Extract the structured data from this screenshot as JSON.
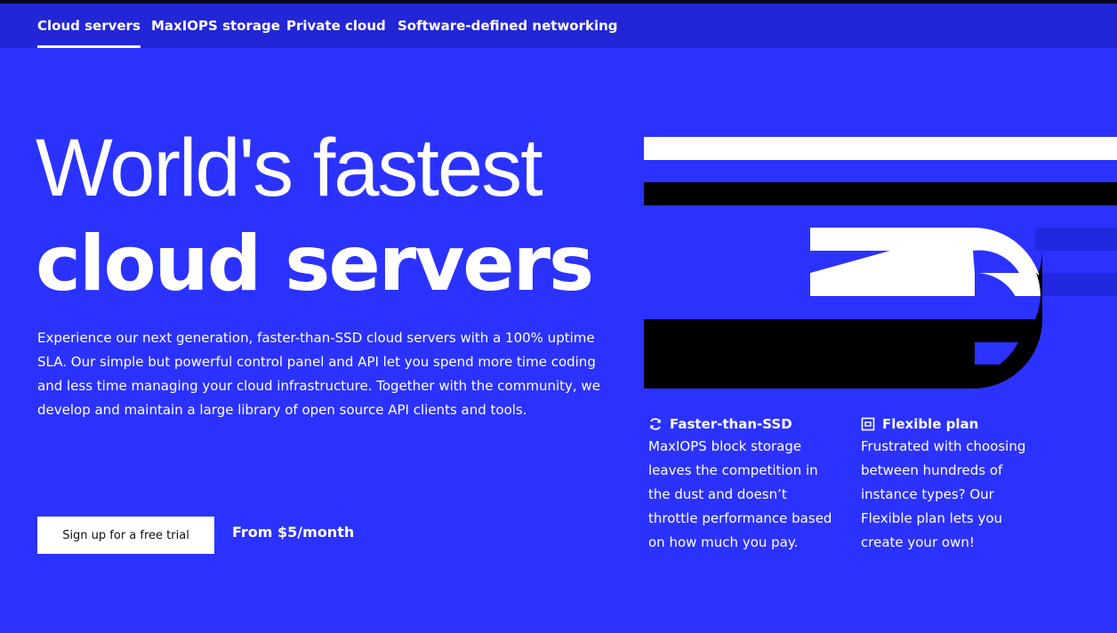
{
  "nav": {
    "items": [
      {
        "label": "Cloud servers",
        "active": true
      },
      {
        "label": "MaxIOPS storage",
        "active": false
      },
      {
        "label": "Private cloud",
        "active": false
      },
      {
        "label": "Software-defined networking",
        "active": false
      }
    ]
  },
  "hero": {
    "headline_line1": "World's fastest",
    "headline_line2": "cloud servers",
    "description": "Experience our next generation, faster-than-SSD cloud servers with a 100% uptime SLA. Our simple but powerful control panel and API let you spend more time coding and less time managing your cloud infrastructure. Together with the community, we develop and maintain a large library of open source API clients and tools.",
    "cta_label": "Sign up for a free trial",
    "price_label": "From $5/month"
  },
  "features": [
    {
      "icon": "refresh-icon",
      "title": "Faster-than-SSD",
      "body": "MaxIOPS block storage leaves the competition in the dust and doesn’t throttle performance based on how much you pay."
    },
    {
      "icon": "flexible-plan-icon",
      "title": "Flexible plan",
      "body": "Frustrated with choosing between hundreds of instance types? Our Flexible plan lets you create your own!"
    }
  ],
  "colors": {
    "background": "#2b32fe",
    "nav_background": "#2226d6",
    "accent_dark": "#1f24c8",
    "text": "#ffffff"
  }
}
